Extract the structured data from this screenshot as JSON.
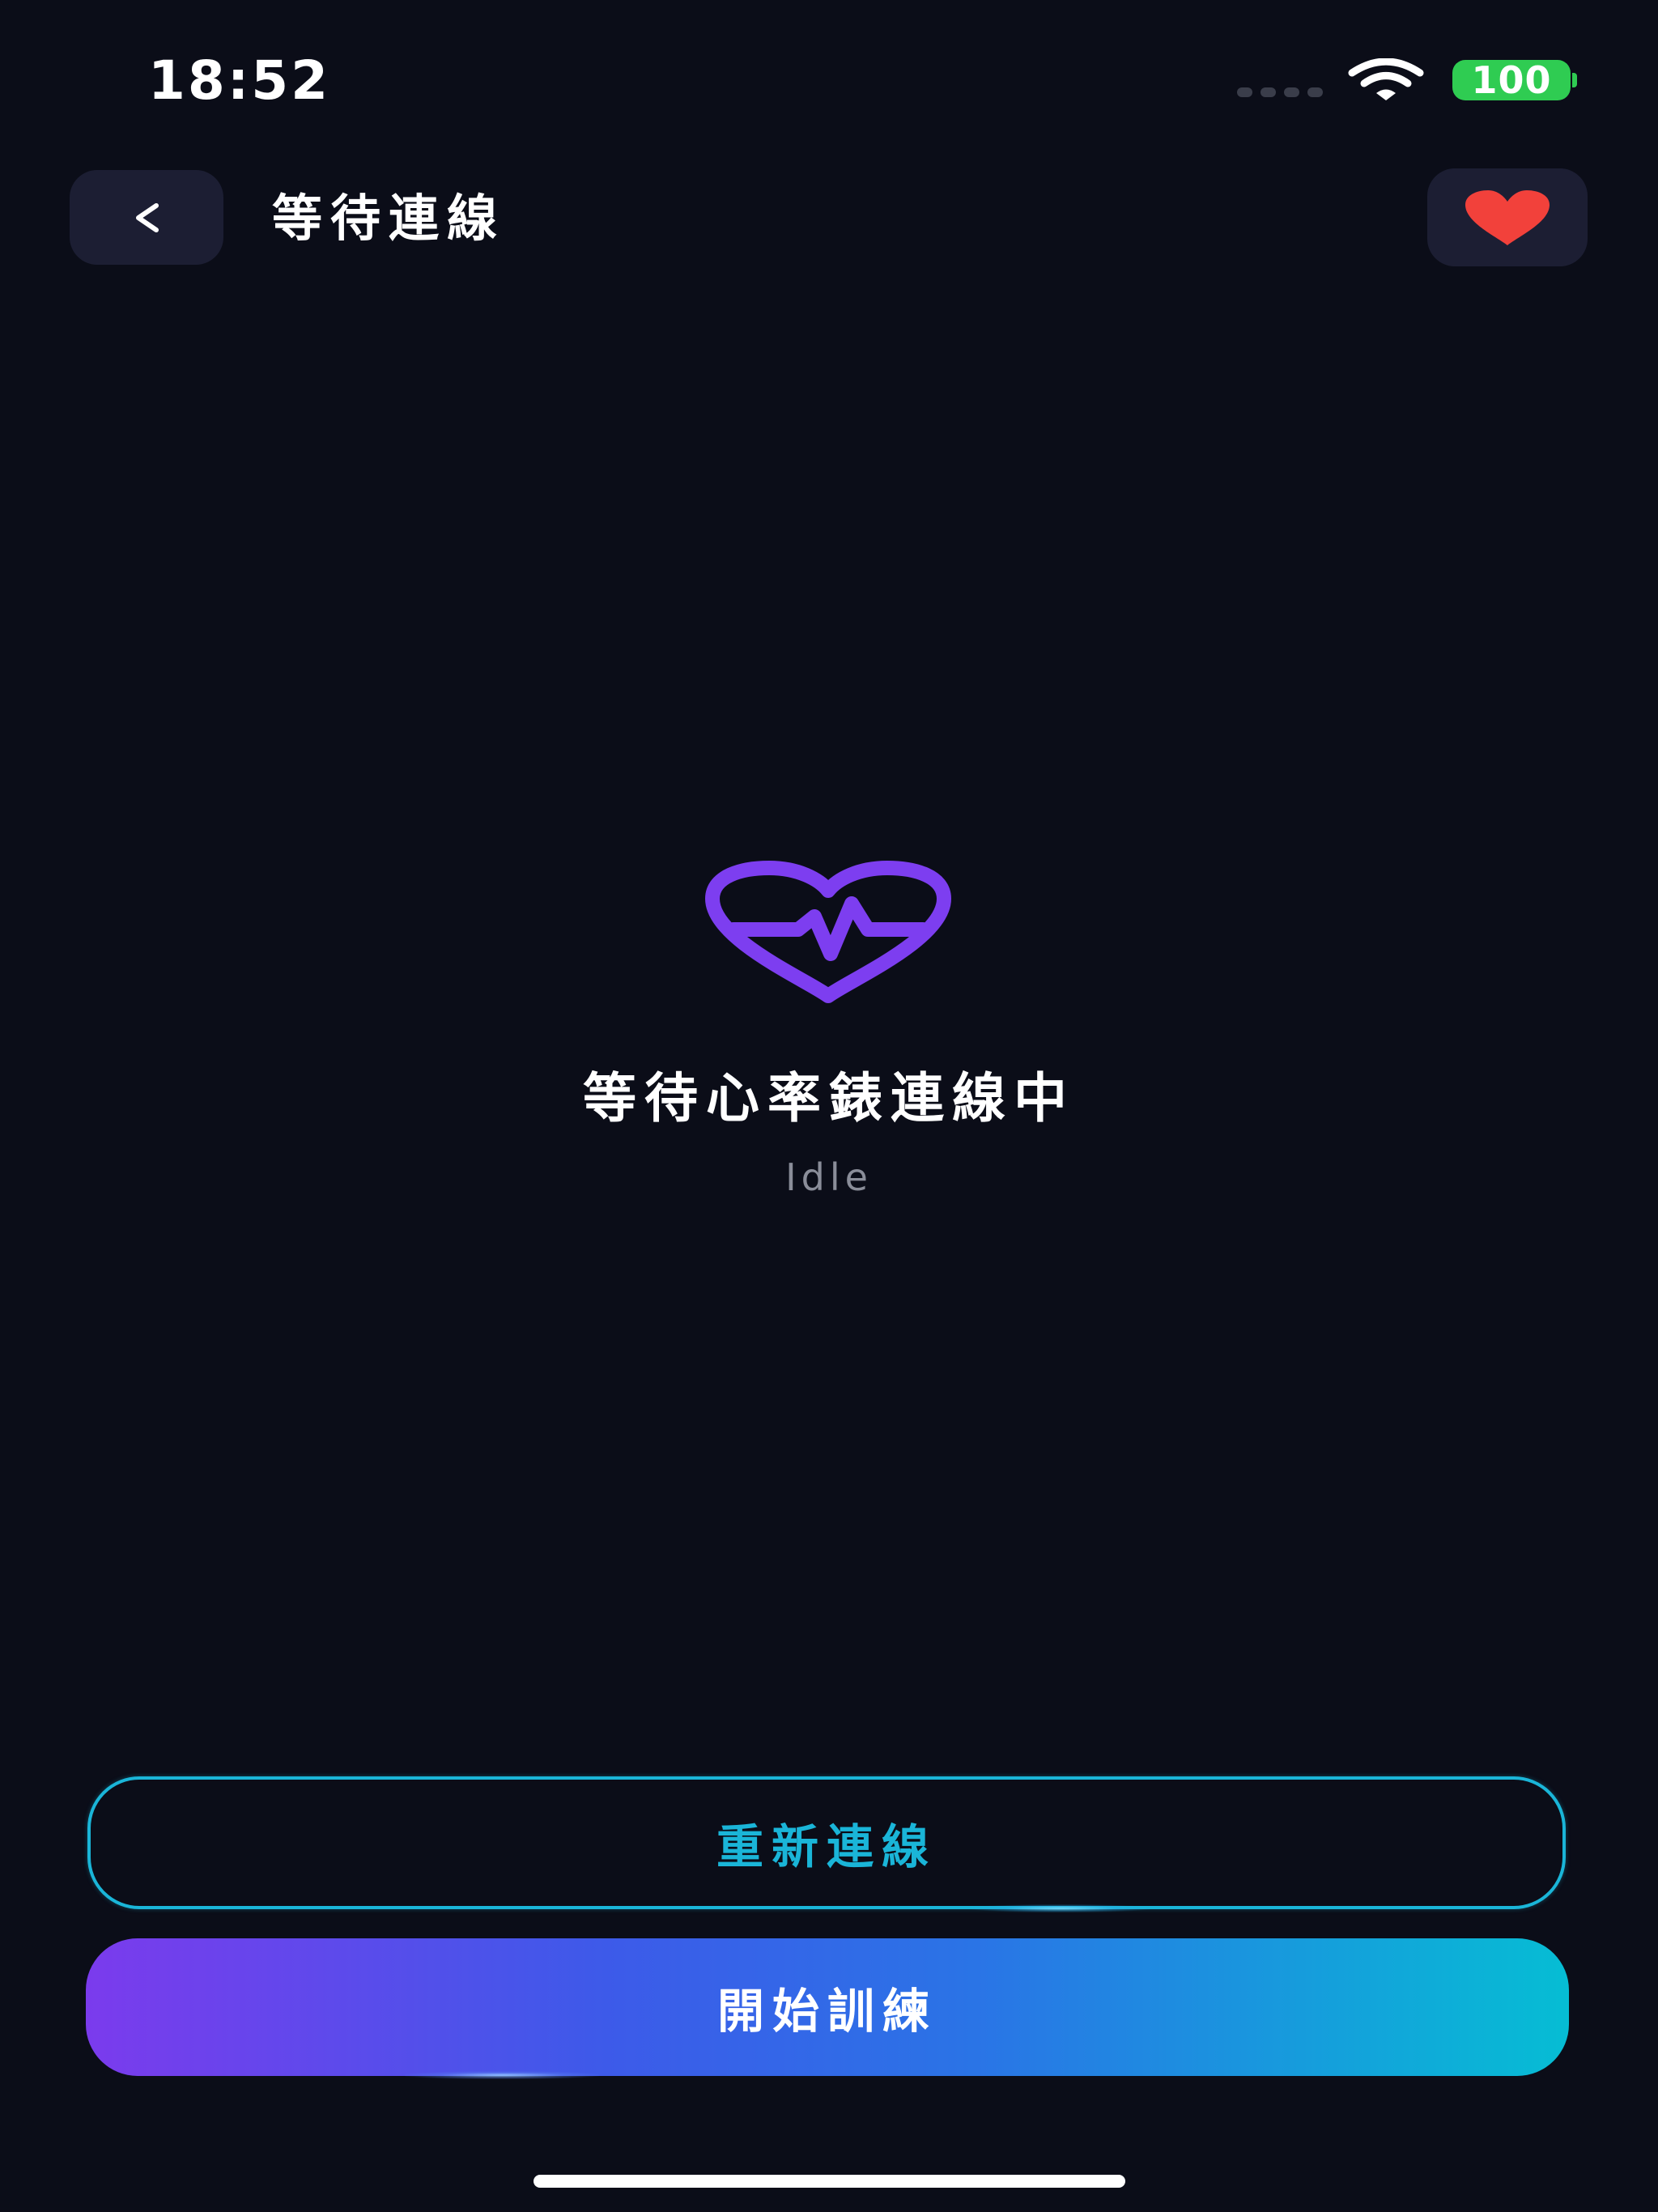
{
  "status_bar": {
    "time": "18:52",
    "battery_level": "100",
    "signal_icon": "signal-bars-icon",
    "wifi_icon": "wifi-icon",
    "battery_color": "#2fcc52"
  },
  "header": {
    "back_icon": "chevron-left-icon",
    "title": "等待連線",
    "favorite_icon": "heart-icon",
    "favorite_color": "#f2413b"
  },
  "main": {
    "icon": "heart-pulse-icon",
    "icon_color": "#7d3ef0",
    "status_title": "等待心率錶連線中",
    "status_subtitle": "Idle"
  },
  "actions": {
    "reconnect_label": "重新連線",
    "start_label": "開始訓練",
    "accent_color": "#1ab5d8"
  }
}
